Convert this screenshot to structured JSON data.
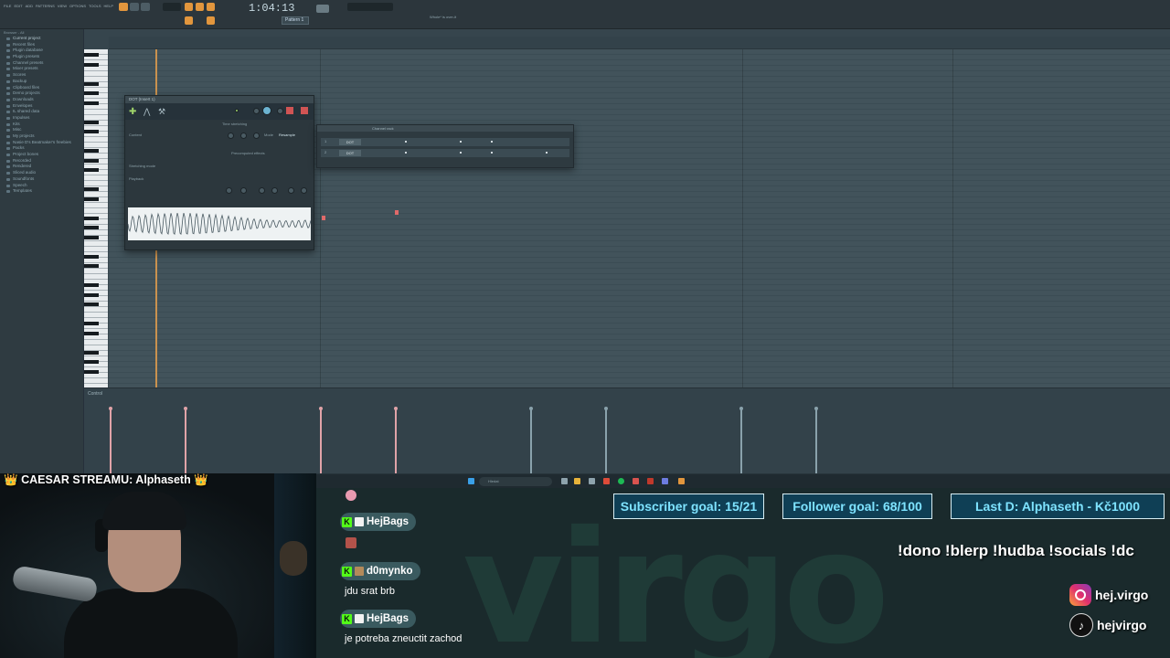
{
  "daw": {
    "menu": [
      "FILE",
      "EDIT",
      "ADD",
      "PATTERNS",
      "VIEW",
      "OPTIONS",
      "TOOLS",
      "HELP"
    ],
    "time": "1:04:13",
    "pattern": "Pattern 1",
    "hint": "Whole* is over-it",
    "browser_title": "Browser - All",
    "browser_items": [
      "Current project",
      "Recent files",
      "Plugin database",
      "Plugin presets",
      "Channel presets",
      "Mixer presets",
      "Scores",
      "Backup",
      "Clipboard files",
      "Demo projects",
      "Downloads",
      "Envelopes",
      "IL shared data",
      "Impulses",
      "Kits",
      "Misc",
      "My projects",
      "Nasie D's Beatmaker's freebies",
      "Packs",
      "Project bones",
      "Recorded",
      "Rendered",
      "Sliced audio",
      "Soundfonts",
      "Speech",
      "Templates"
    ],
    "control_label": "Control",
    "sampler": {
      "title": "DOT (Insert 1)",
      "panels": [
        "Content",
        "Time stretching",
        "Playback",
        "Precomputed effects"
      ],
      "stretch_mode_label": "Stretching mode",
      "mode_label": "Mode",
      "mode_value": "Resample"
    },
    "channel_rack": {
      "title": "Channel rack",
      "rows": [
        {
          "index": "1",
          "name": "DOT"
        },
        {
          "index": "2",
          "name": "DOT"
        }
      ]
    },
    "taskbar_search": "Hledat"
  },
  "stream": {
    "caesar_label": "CAESAR STREAMU: Alphaseth",
    "goals": [
      {
        "label": "Subscriber goal: 15/21"
      },
      {
        "label": "Follower goal: 68/100"
      },
      {
        "label": "Last D: Alphaseth - Kč1000"
      }
    ],
    "commands": "!dono !blerp !hudba !socials !dc",
    "socials": [
      {
        "icon": "instagram-icon",
        "handle": "hej.virgo"
      },
      {
        "icon": "tiktok-icon",
        "handle": "hejvirgo"
      }
    ],
    "logo_text": "virgo",
    "chat": [
      {
        "user": "HejBags",
        "message": ""
      },
      {
        "user": "d0mynko",
        "message": "jdu srat brb"
      },
      {
        "user": "HejBags",
        "message": "je potreba zneuctit zachod"
      }
    ],
    "colors": {
      "goal_text": "#7ee3ff",
      "goal_bg": "#0f3f55",
      "kick_green": "#53fc18",
      "playhead": "#e29e4e"
    }
  }
}
